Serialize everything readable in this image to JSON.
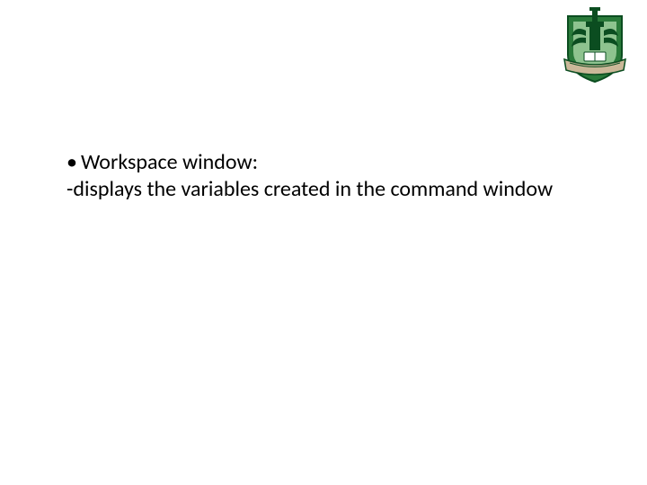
{
  "content": {
    "bullet_mark": "•",
    "bullet_text": "Workspace window:",
    "dash_line": "-displays the variables created in the command window"
  },
  "logo": {
    "name": "university-crest",
    "colors": {
      "dark_green": "#0b4d20",
      "mid_green": "#2a7a3a",
      "light_green": "#8ec38f",
      "banner_tan": "#cbb899",
      "white": "#ffffff"
    }
  }
}
